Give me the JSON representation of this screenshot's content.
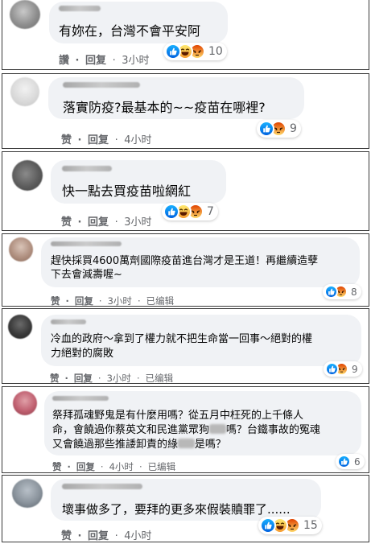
{
  "comments": [
    {
      "text": "有妳在，台灣不會平安阿",
      "like": "讚",
      "reply": "回复",
      "sep": "·",
      "time": "3小时",
      "edited": "",
      "reactions": [
        "like",
        "haha",
        "angry"
      ],
      "count": "10"
    },
    {
      "text": "落實防疫?最基本的~~疫苗在哪裡?",
      "like": "赞",
      "reply": "回复",
      "sep": "·",
      "time": "4小时",
      "edited": "",
      "reactions": [
        "like",
        "angry"
      ],
      "count": "9"
    },
    {
      "text": "快一點去買疫苗啦網紅",
      "like": "赞",
      "reply": "回复",
      "sep": "·",
      "time": "3小时",
      "edited": "",
      "reactions": [
        "like",
        "haha",
        "angry"
      ],
      "count": "7"
    },
    {
      "text": "趕快採買4600萬劑國際疫苗進台灣才是王道！再繼續造孽\n下去會減壽喔~",
      "like": "赞",
      "reply": "回复",
      "sep": "·",
      "time": "3小时",
      "edited": "已编辑",
      "reactions": [
        "like",
        "angry"
      ],
      "count": "8"
    },
    {
      "text": "冷血的政府～拿到了權力就不把生命當一回事～絕對的權\n力絕對的腐敗",
      "like": "赞",
      "reply": "回复",
      "sep": "·",
      "time": "3小时",
      "edited": "已编辑",
      "reactions": [
        "like",
        "angry"
      ],
      "count": "9"
    },
    {
      "text_parts": [
        "祭拜孤魂野鬼是有什麼用嗎？從五月中枉死的上千條人\n命，會饒過你蔡英文和民進黨眾狗",
        "嗎？台鐵事故的冤魂\n又會饒過那些推諉卸責的綠",
        "是嗎？"
      ],
      "like": "赞",
      "reply": "回复",
      "sep": "·",
      "time": "4小时",
      "edited": "已编辑",
      "reactions": [
        "like"
      ],
      "count": "6"
    },
    {
      "text": "壞事做多了，要拜的更多來假裝贖罪了......",
      "like": "赞",
      "reply": "回复",
      "sep": "·",
      "time": "4小时",
      "edited": "",
      "reactions": [
        "like",
        "haha",
        "angry"
      ],
      "count": "15"
    }
  ],
  "icons": {
    "like": "thumbs-up-icon",
    "haha": "laughing-face-icon",
    "angry": "angry-face-icon"
  },
  "colors": {
    "bubble": "#f0f2f5",
    "meta": "#65676b",
    "like_blue": "#1877f2"
  }
}
